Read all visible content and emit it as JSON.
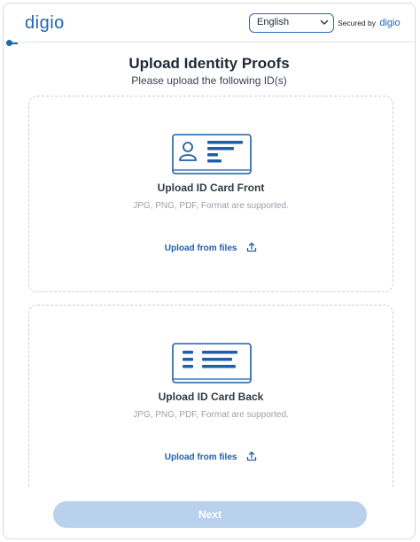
{
  "header": {
    "logo": "digio",
    "language": {
      "selected": "English"
    },
    "secured_by_label": "Secured by",
    "secured_by_brand": "digio"
  },
  "main": {
    "title": "Upload Identity Proofs",
    "subtitle": "Please upload the following ID(s)",
    "cards": [
      {
        "title": "Upload ID Card Front",
        "formats": "JPG, PNG, PDF, Format are supported.",
        "upload_label": "Upload from files",
        "icon": "id-card-front-icon"
      },
      {
        "title": "Upload ID Card Back",
        "formats": "JPG, PNG, PDF, Format are supported.",
        "upload_label": "Upload from files",
        "icon": "id-card-back-icon"
      }
    ]
  },
  "footer": {
    "next_label": "Next"
  },
  "colors": {
    "accent": "#2266b0",
    "button_disabled": "#b9d1ec",
    "card_border": "#c9cfe0"
  }
}
